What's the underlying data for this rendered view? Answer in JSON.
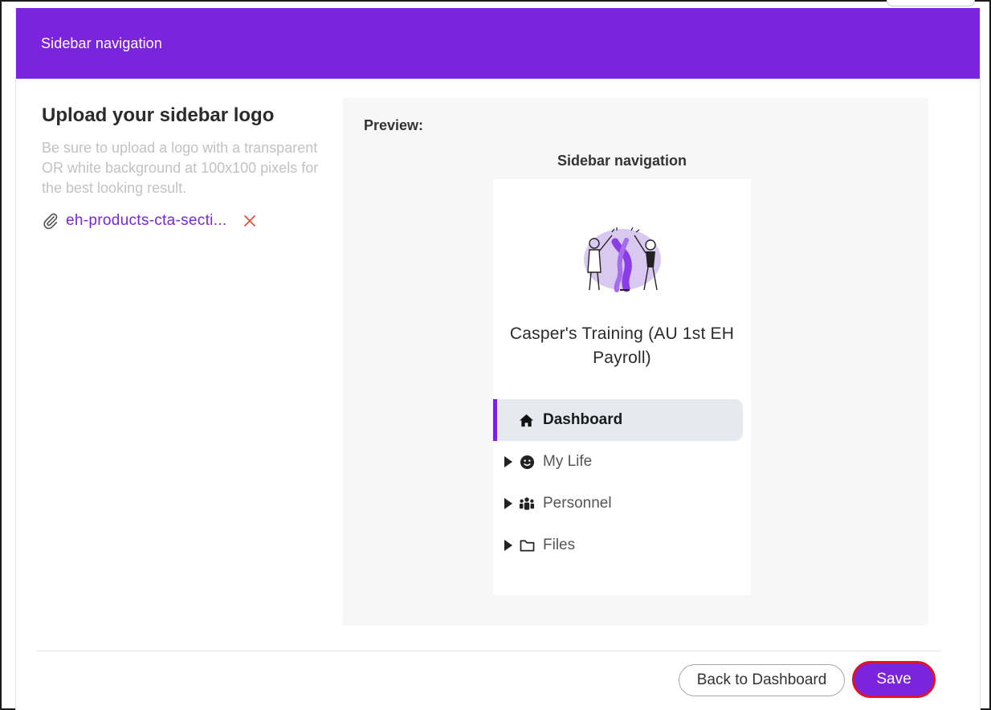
{
  "modal": {
    "header_title": "Sidebar navigation"
  },
  "upload": {
    "title": "Upload your sidebar logo",
    "help_text": "Be sure to upload a logo with a transparent OR white background at 100x100 pixels for the best looking result.",
    "file_name": "eh-products-cta-secti..."
  },
  "preview": {
    "label": "Preview:",
    "title": "Sidebar navigation",
    "org_name": "Casper's Training (AU 1st EH Payroll)",
    "nav_items": [
      {
        "label": "Dashboard",
        "icon": "home-icon",
        "active": true
      },
      {
        "label": "My Life",
        "icon": "smile-icon",
        "active": false
      },
      {
        "label": "Personnel",
        "icon": "users-icon",
        "active": false
      },
      {
        "label": "Files",
        "icon": "folder-icon",
        "active": false
      }
    ]
  },
  "footer": {
    "back_label": "Back to Dashboard",
    "save_label": "Save"
  },
  "colors": {
    "brand": "#7b24de",
    "accent_red": "#e3122b",
    "panel_bg": "#f7f7f7"
  }
}
